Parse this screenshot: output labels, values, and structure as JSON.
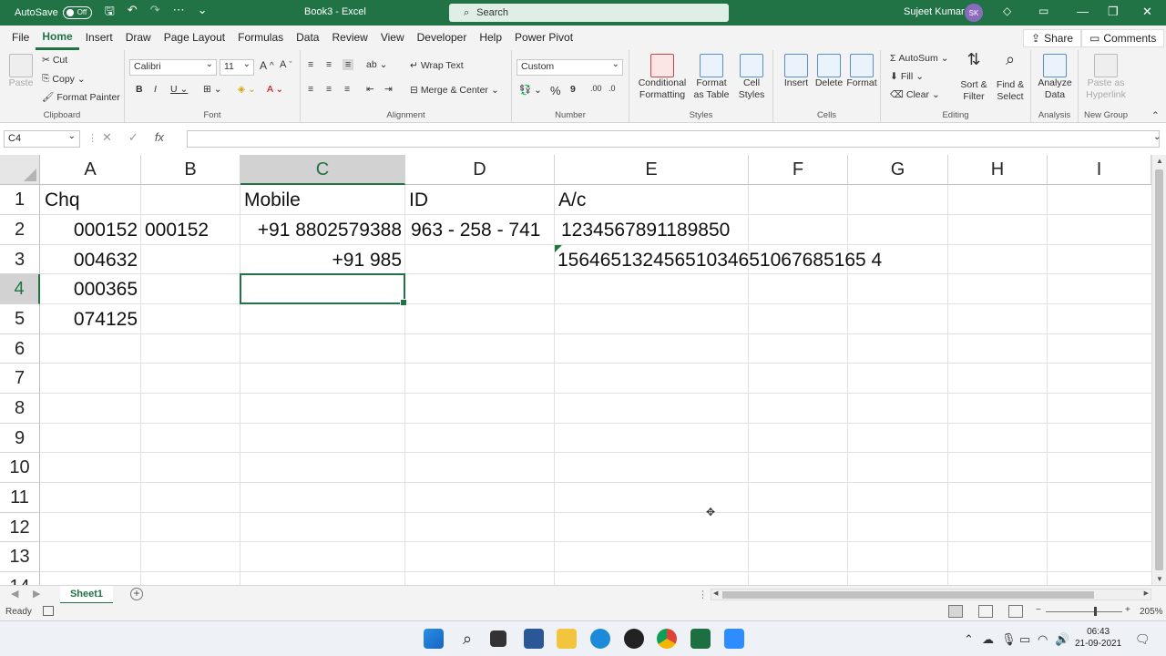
{
  "titlebar": {
    "autosave_label": "AutoSave",
    "autosave_state": "Off",
    "doc_title": "Book3  -  Excel",
    "search_placeholder": "Search",
    "user_name": "Sujeet Kumar",
    "user_initials": "SK"
  },
  "menu": {
    "tabs": [
      "File",
      "Home",
      "Insert",
      "Draw",
      "Page Layout",
      "Formulas",
      "Data",
      "Review",
      "View",
      "Developer",
      "Help",
      "Power Pivot"
    ],
    "active": "Home",
    "share": "Share",
    "comments": "Comments"
  },
  "ribbon": {
    "clipboard": {
      "label": "Clipboard",
      "paste": "Paste",
      "cut": "Cut",
      "copy": "Copy",
      "format_painter": "Format Painter"
    },
    "font": {
      "label": "Font",
      "family": "Calibri",
      "size": "11"
    },
    "alignment": {
      "label": "Alignment",
      "wrap_text": "Wrap Text",
      "merge_center": "Merge & Center"
    },
    "number": {
      "label": "Number",
      "format": "Custom"
    },
    "styles": {
      "label": "Styles",
      "conditional": "Conditional Formatting",
      "format_table": "Format as Table",
      "cell_styles": "Cell Styles"
    },
    "cells": {
      "label": "Cells",
      "insert": "Insert",
      "delete": "Delete",
      "format": "Format"
    },
    "editing": {
      "label": "Editing",
      "autosum": "AutoSum",
      "fill": "Fill",
      "clear": "Clear",
      "sort_filter": "Sort & Filter",
      "find_select": "Find & Select"
    },
    "analysis": {
      "label": "Analysis",
      "analyze_data": "Analyze Data"
    },
    "new_group": {
      "label": "New Group",
      "paste_hyperlink": "Paste as Hyperlink"
    }
  },
  "formula_bar": {
    "name_box": "C4",
    "fx": "fx",
    "content": ""
  },
  "sheet": {
    "columns": [
      "A",
      "B",
      "C",
      "D",
      "E",
      "F",
      "G",
      "H",
      "I"
    ],
    "rows": [
      "1",
      "2",
      "3",
      "4",
      "5",
      "6",
      "7",
      "8",
      "9",
      "10",
      "11",
      "12",
      "13",
      "14"
    ],
    "selected_cell": "C4",
    "cells": {
      "A1": "Chq",
      "C1": "Mobile",
      "D1": "ID",
      "E1": "A/c",
      "A2": "000152",
      "B2": "000152",
      "C2": "+91 8802579388",
      "D2": "963 - 258 - 741",
      "E2": "1234567891189850",
      "A3": "004632",
      "C3": "+91 985",
      "E3": "15646513245651034651067685165 4",
      "A4": "000365",
      "A5": "074125"
    }
  },
  "sheet_tabs": {
    "active": "Sheet1"
  },
  "status": {
    "ready": "Ready",
    "zoom": "205%"
  },
  "taskbar": {
    "time": "06:43",
    "date": "21-09-2021"
  }
}
